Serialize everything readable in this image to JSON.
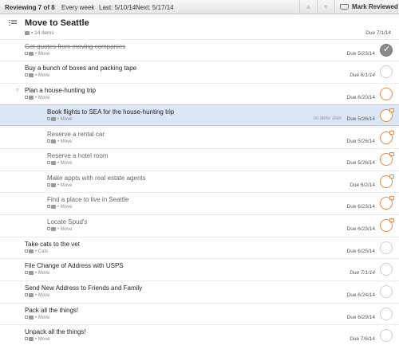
{
  "review": {
    "progress": "Reviewing 7 of 8",
    "frequency": "Every week",
    "last": "Last: 5/10/14",
    "next": "Next: 5/17/14",
    "prev_icon": "triangle-up-icon",
    "next_icon": "triangle-down-icon",
    "mark_reviewed_label": "Mark Reviewed"
  },
  "project": {
    "title": "Move to Seattle",
    "meta": "• 14 items",
    "due": "Due 7/1/14"
  },
  "tasks": [
    {
      "name": "Get quotes from moving companies",
      "context": "• Move",
      "due": "Due 5/23/14",
      "status": "completed",
      "defer": ""
    },
    {
      "name": "Buy a bunch of boxes and packing tape",
      "context": "• Move",
      "due": "Due 6/1/14",
      "status": "available",
      "defer": ""
    },
    {
      "name": "Plan a house-hunting trip",
      "context": "• Move",
      "due": "Due 6/20/14",
      "status": "group",
      "defer": ""
    },
    {
      "name": "Book flights to SEA for the house-hunting trip",
      "context": "• Move",
      "due": "Due 5/26/14",
      "status": "flagged",
      "defer": "no defer date"
    },
    {
      "name": "Reserve a rental car",
      "context": "• Move",
      "due": "Due 5/26/14",
      "status": "flagged",
      "defer": ""
    },
    {
      "name": "Reserve a hotel room",
      "context": "• Move",
      "due": "Due 5/26/14",
      "status": "flagged",
      "defer": ""
    },
    {
      "name": "Make appts with real estate agents",
      "context": "• Move",
      "due": "Due 6/2/14",
      "status": "flagged",
      "defer": ""
    },
    {
      "name": "Find a place to live in Seattle",
      "context": "• Move",
      "due": "Due 6/23/14",
      "status": "flagged",
      "defer": ""
    },
    {
      "name": "Locate Spud's",
      "context": "• Move",
      "due": "Due 6/23/14",
      "status": "flagged",
      "defer": ""
    },
    {
      "name": "Take cats to the vet",
      "context": "• Cats",
      "due": "Due 6/25/14",
      "status": "plain",
      "defer": ""
    },
    {
      "name": "File Change of Address with USPS",
      "context": "• Move",
      "due": "Due 7/1/14",
      "status": "plain",
      "defer": ""
    },
    {
      "name": "Send New Address to Friends and Family",
      "context": "• Move",
      "due": "Due 6/24/14",
      "status": "plain",
      "defer": ""
    },
    {
      "name": "Pack all the things!",
      "context": "• Move",
      "due": "Due 6/29/14",
      "status": "plain",
      "defer": ""
    },
    {
      "name": "Unpack all the things!",
      "context": "• Move",
      "due": "Due 7/6/14",
      "status": "plain",
      "defer": ""
    }
  ],
  "colors": {
    "accent_orange": "#e8894a",
    "selected_row": "#dbe7f6",
    "completed_check": "#8a8a8a"
  }
}
